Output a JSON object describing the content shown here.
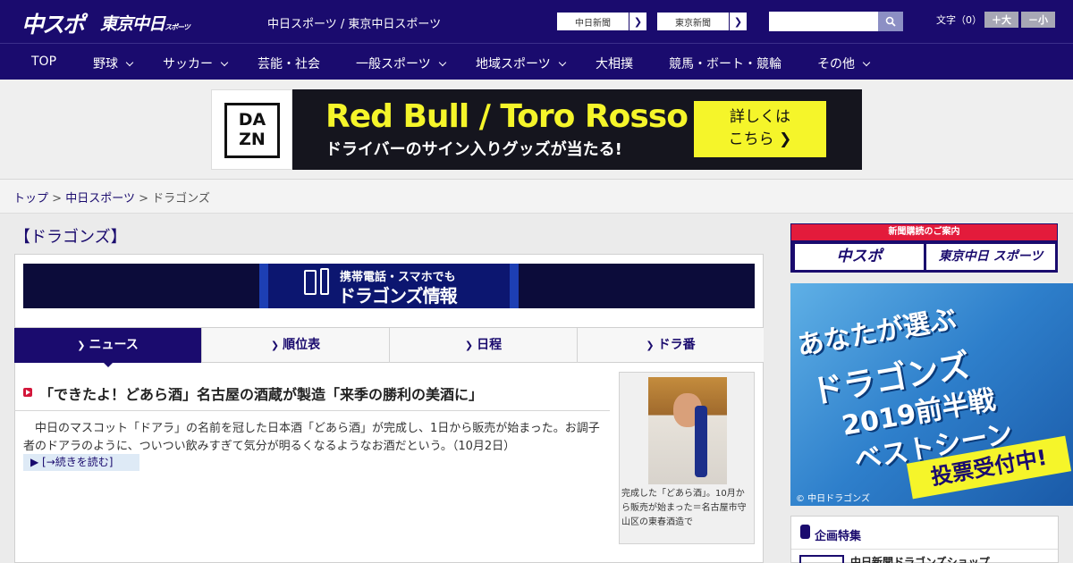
{
  "header": {
    "logo_chuspo": "中スポ",
    "logo_tokyo": "東京中日",
    "logo_tokyo_small": "スポーツ",
    "site_name": "中日スポーツ / 東京中日スポーツ",
    "paper_buttons": [
      "中日新聞",
      "東京新聞"
    ],
    "search_placeholder": "",
    "font_size_label": "文字（0）",
    "font_bigger": "＋大",
    "font_smaller": "－小"
  },
  "nav": {
    "items": [
      {
        "label": "TOP",
        "dropdown": false
      },
      {
        "label": "野球",
        "dropdown": true
      },
      {
        "label": "サッカー",
        "dropdown": true
      },
      {
        "label": "芸能・社会",
        "dropdown": false
      },
      {
        "label": "一般スポーツ",
        "dropdown": true
      },
      {
        "label": "地域スポーツ",
        "dropdown": true
      },
      {
        "label": "大相撲",
        "dropdown": false
      },
      {
        "label": "競馬・ボート・競輪",
        "dropdown": false
      },
      {
        "label": "その他",
        "dropdown": true
      }
    ]
  },
  "ad": {
    "brand": "DA ZN",
    "title": "Red Bull / Toro Rosso",
    "subtitle": "ドライバーのサイン入りグッズが当たる!",
    "cta_line1": "詳しくは",
    "cta_line2": "こちら ❯"
  },
  "breadcrumb": {
    "items": [
      "トップ",
      "中日スポーツ",
      "ドラゴンズ"
    ],
    "separator": ">"
  },
  "page": {
    "title": "【ドラゴンズ】"
  },
  "mobile_banner": {
    "line1": "携帯電話・スマホでも",
    "line2": "ドラゴンズ情報"
  },
  "tabs": [
    {
      "label": "ニュース",
      "active": true
    },
    {
      "label": "順位表",
      "active": false
    },
    {
      "label": "日程",
      "active": false
    },
    {
      "label": "ドラ番",
      "active": false
    }
  ],
  "article": {
    "title": "「できたよ！どあら酒」名古屋の酒蔵が製造「来季の勝利の美酒に」",
    "body": "　中日のマスコット「ドアラ」の名前を冠した日本酒「どあら酒」が完成し、1日から販売が始まった。お調子者のドアラのように、ついつい飲みすぎて気分が明るくなるようなお酒だという。（10月2日）",
    "more": "▶ [→続きを読む]",
    "photo_caption": "完成した「どあら酒」。10月から販売が始まった＝名古屋市守山区の東春酒造で"
  },
  "sidebar": {
    "subscription_header": "新聞購読のご案内",
    "subscription_buttons": [
      "中スポ",
      "東京中日 スポーツ"
    ],
    "vote_ad": {
      "lines": [
        "あなたが選ぶ",
        "ドラゴンズ",
        "2019前半戦",
        "ベストシーン"
      ],
      "cta": "投票受付中!",
      "copyright": "© 中日ドラゴンズ"
    },
    "feature_title": "企画特集",
    "feature_item": "中日新聞ドラゴンズショップ"
  },
  "colors": {
    "brand_navy": "#1a0b6e",
    "accent_red": "#e31b3b",
    "ad_yellow": "#f5f52a"
  }
}
